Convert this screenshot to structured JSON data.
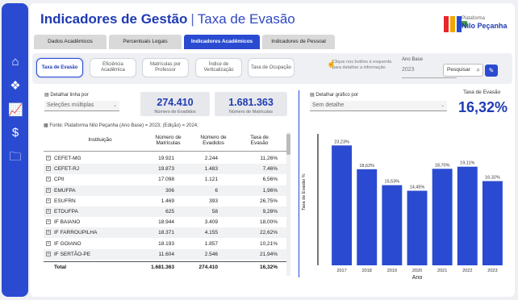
{
  "app": {
    "title": "Indicadores de Gestão",
    "subtitle": "Taxa de Evasão",
    "logo_brand_small": "Plataforma",
    "logo_brand": "Nilo Peçanha"
  },
  "tabs": [
    {
      "label": "Dados Acadêmicos",
      "active": false
    },
    {
      "label": "Percentuais Legais",
      "active": false
    },
    {
      "label": "Indicadores Acadêmicos",
      "active": true
    },
    {
      "label": "Indicadores de Pessoal",
      "active": false
    }
  ],
  "subnav": [
    {
      "label": "Taxa de Evasão",
      "active": true
    },
    {
      "label": "Eficiência Acadêmica",
      "active": false
    },
    {
      "label": "Matrículas por Professor",
      "active": false
    },
    {
      "label": "Índice de Verticalização",
      "active": false
    },
    {
      "label": "Taxa de Ocupação",
      "active": false
    }
  ],
  "hint": "Clique nos botões à esquerda para detalhar a informação",
  "ano_base": {
    "label": "Ano Base",
    "value": "2023"
  },
  "search": {
    "label": "Pesquisar"
  },
  "left_filter": {
    "label": "Detalhar linha por",
    "value": "Seleções múltiplas"
  },
  "cards": [
    {
      "value": "274.410",
      "caption": "Número de Evadidos"
    },
    {
      "value": "1.681.363",
      "caption": "Número de Matrículas"
    }
  ],
  "source": "Fonte: Plataforma Nilo Peçanha (Ano Base) = 2023; (Edição) = 2024;",
  "table": {
    "headers": [
      "Instituição",
      "Número de Matrículas",
      "Número de Evadidos",
      "Taxa de Evasão"
    ],
    "rows": [
      [
        "CEFET-MG",
        "19.921",
        "2.244",
        "11,26%"
      ],
      [
        "CEFET-RJ",
        "19.873",
        "1.483",
        "7,46%"
      ],
      [
        "CPII",
        "17.098",
        "1.121",
        "6,56%"
      ],
      [
        "EMUFPA",
        "306",
        "6",
        "1,96%"
      ],
      [
        "ESUFRN",
        "1.469",
        "393",
        "26,75%"
      ],
      [
        "ETDUFPA",
        "625",
        "58",
        "9,28%"
      ],
      [
        "IF BAIANO",
        "18.944",
        "3.409",
        "18,00%"
      ],
      [
        "IF FARROUPILHA",
        "18.371",
        "4.155",
        "22,62%"
      ],
      [
        "IF GOIANO",
        "18.193",
        "1.857",
        "10,21%"
      ],
      [
        "IF SERTÃO-PE",
        "11.604",
        "2.546",
        "21,94%"
      ]
    ],
    "total": [
      "Total",
      "1.681.363",
      "274.410",
      "16,32%"
    ]
  },
  "right_filter": {
    "label": "Detalhar gráfico por",
    "value": "Sem detalhe"
  },
  "kpi": {
    "label": "Taxa de Evasão",
    "value": "16,32%"
  },
  "chart_data": {
    "type": "bar",
    "categories": [
      "2017",
      "2018",
      "2019",
      "2020",
      "2021",
      "2022",
      "2023"
    ],
    "values": [
      23.23,
      18.62,
      15.53,
      14.45,
      18.7,
      19.11,
      16.32
    ],
    "data_labels": [
      "23,23%",
      "18,62%",
      "15,53%",
      "14,45%",
      "18,70%",
      "19,11%",
      "16,32%"
    ],
    "xlabel": "Ano",
    "ylabel": "Taxa de Evasão %",
    "ylim": [
      0,
      25
    ],
    "color": "#2a4bd1"
  }
}
